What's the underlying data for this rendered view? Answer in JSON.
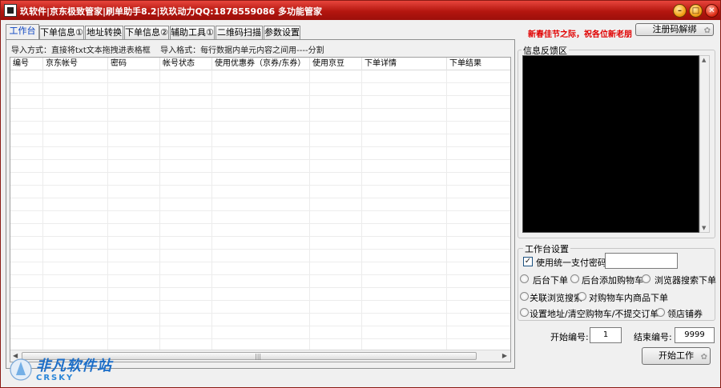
{
  "window": {
    "title": "玖软件|京东极致管家|刷单助手8.2|玖玖动力QQ:1878559086 多功能管家",
    "controls": {
      "minimize": "–",
      "maximize": "□",
      "close": "✕"
    }
  },
  "tabs": [
    {
      "label": "工作台",
      "active": true
    },
    {
      "label": "下单信息①"
    },
    {
      "label": "地址转换"
    },
    {
      "label": "下单信息②"
    },
    {
      "label": "辅助工具①"
    },
    {
      "label": "二维码扫描"
    },
    {
      "label": "参数设置"
    }
  ],
  "header": {
    "notice": "新春佳节之际，祝各位新老朋",
    "register_button": "注册码解绑"
  },
  "import": {
    "method_label": "导入方式：直接将txt文本拖拽进表格框",
    "format_label": "导入格式：每行数据内单元内容之间用----分割"
  },
  "grid": {
    "columns": [
      "编号",
      "京东帐号",
      "密码",
      "帐号状态",
      "使用优惠券（京券/东券）",
      "使用京豆",
      "下单详情",
      "下单结果"
    ],
    "scroll_grip": "|||"
  },
  "feedback": {
    "title": "信息反馈区"
  },
  "workbench": {
    "title": "工作台设置",
    "unified_pay_label": "使用统一支付密码:",
    "unified_pay_checked": true,
    "unified_pay_value": "",
    "options": [
      "后台下单",
      "后台添加购物车",
      "浏览器搜索下单",
      "关联浏览搜索",
      "对购物车内商品下单",
      "设置地址/清空购物车/不提交订单",
      "领店铺券"
    ]
  },
  "range": {
    "start_label": "开始编号:",
    "start_value": "1",
    "end_label": "结束编号:",
    "end_value": "9999"
  },
  "actions": {
    "start_button": "开始工作"
  },
  "watermark": {
    "text": "非凡软件站",
    "sub": "CRSKY"
  }
}
